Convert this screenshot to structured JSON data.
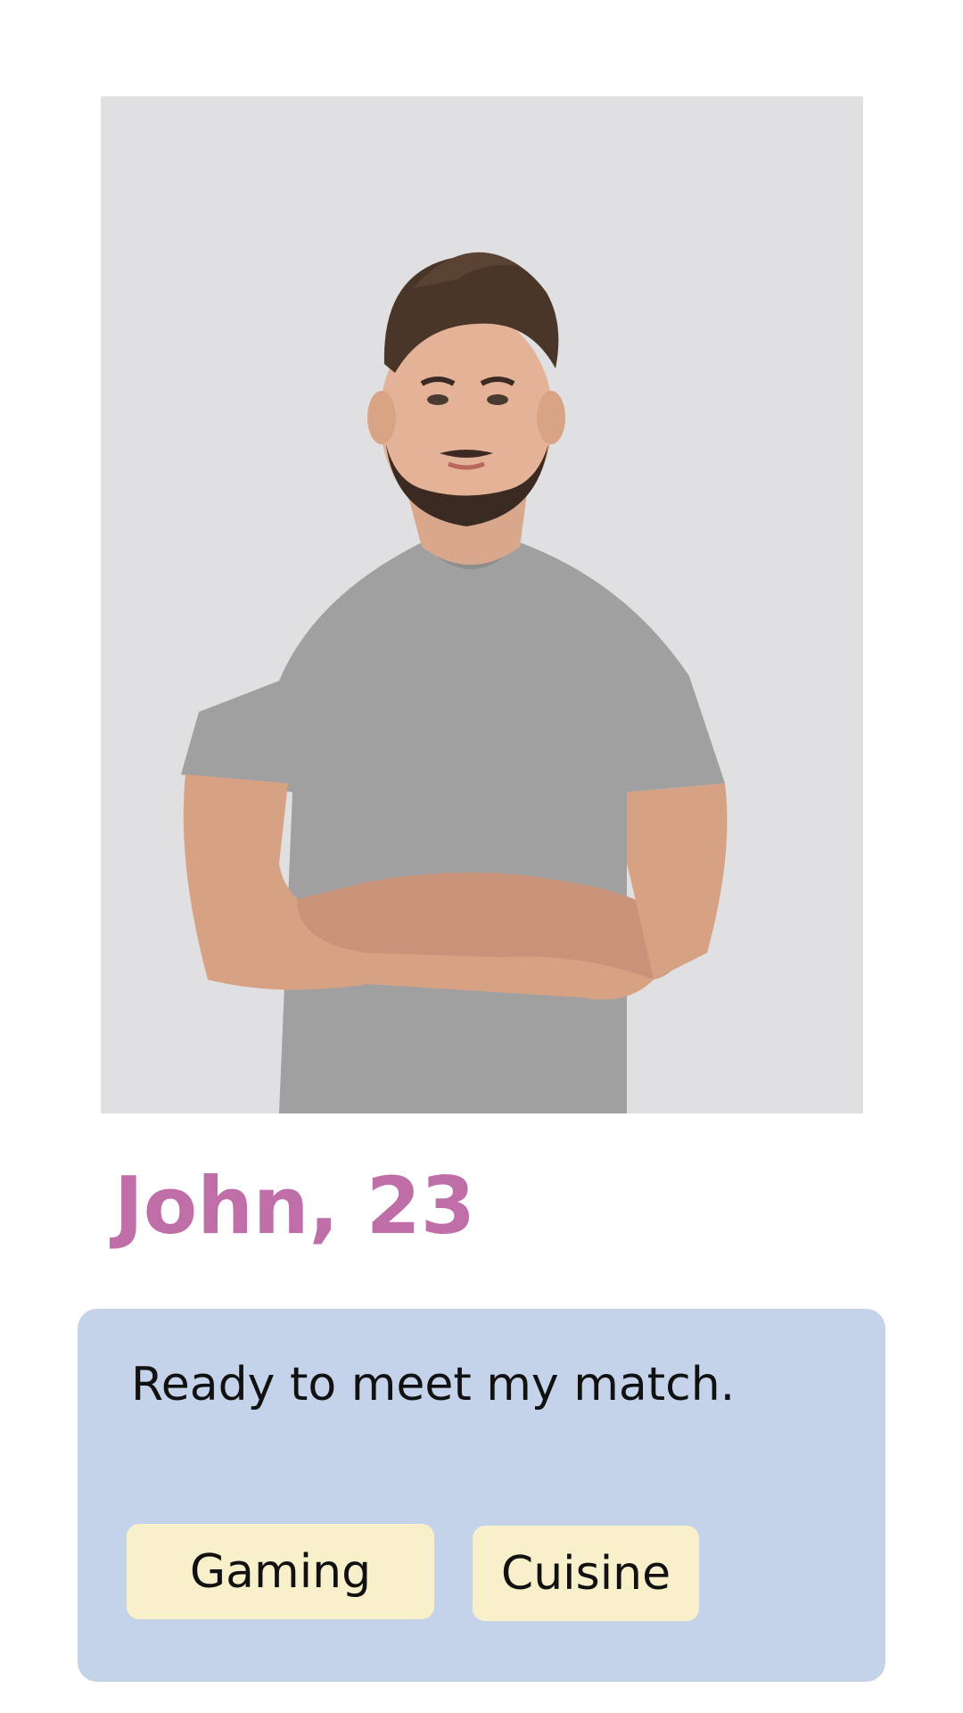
{
  "profile": {
    "name_age": "John, 23",
    "bio": "Ready to meet my match.",
    "interests": [
      "Gaming",
      "Cuisine"
    ]
  },
  "colors": {
    "name": "#bf6ea7",
    "card": "#c4d3ea",
    "tag": "#f8f0cb",
    "photo_bg": "#e0dfe1"
  }
}
